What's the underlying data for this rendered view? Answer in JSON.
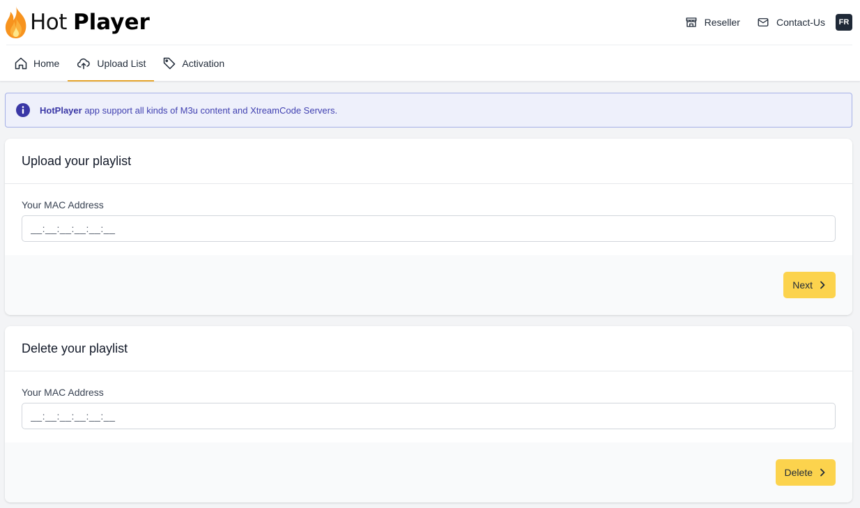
{
  "header": {
    "logo": {
      "light": "Hot",
      "bold": "Player"
    },
    "actions": [
      {
        "label": "Reseller",
        "icon": "store-icon"
      },
      {
        "label": "Contact-Us",
        "icon": "mail-icon"
      }
    ],
    "language": "FR"
  },
  "tabs": [
    {
      "label": "Home",
      "icon": "home-icon",
      "active": false
    },
    {
      "label": "Upload List",
      "icon": "cloud-upload-icon",
      "active": true
    },
    {
      "label": "Activation",
      "icon": "tag-icon",
      "active": false
    }
  ],
  "alert": {
    "brand": "HotPlayer",
    "message": " app support all kinds of M3u content and XtreamCode Servers.",
    "icon": "info-icon"
  },
  "upload_card": {
    "title": "Upload your playlist",
    "field_label": "Your MAC Address",
    "mac_placeholder": "__:__:__:__:__:__",
    "button_label": "Next"
  },
  "delete_card": {
    "title": "Delete your playlist",
    "field_label": "Your MAC Address",
    "mac_placeholder": "__:__:__:__:__:__",
    "button_label": "Delete"
  },
  "colors": {
    "accent": "#e4a42c",
    "button": "#fcd34d",
    "alert_bg": "#eef0fb",
    "alert_text": "#3f3fb0",
    "badge": "#1f2937"
  }
}
